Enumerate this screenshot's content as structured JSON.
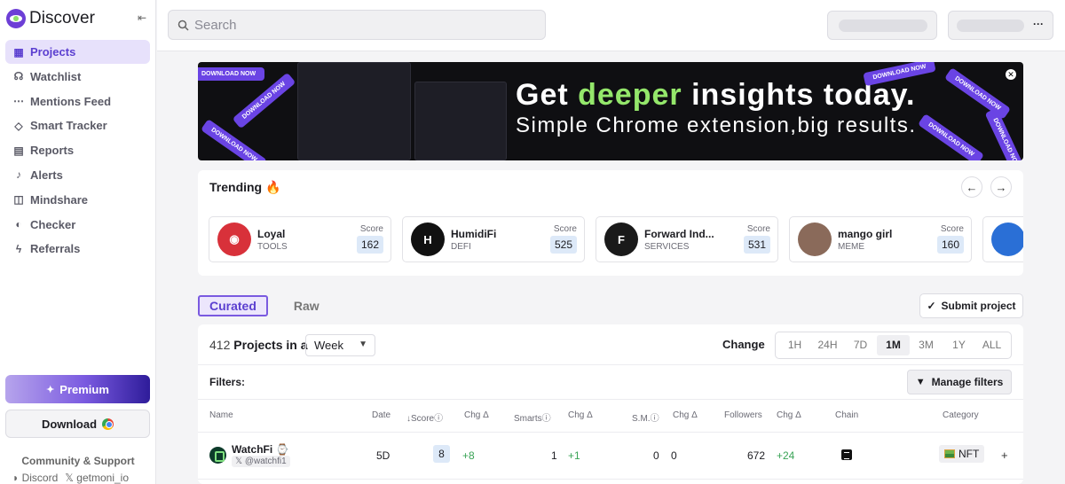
{
  "app": {
    "name": "Discover"
  },
  "sidebar": {
    "items": [
      {
        "label": "Projects",
        "icon": "projects-icon",
        "glyph": "▦",
        "active": true
      },
      {
        "label": "Watchlist",
        "icon": "watchlist-icon",
        "glyph": "☊",
        "active": false
      },
      {
        "label": "Mentions Feed",
        "icon": "mentions-icon",
        "glyph": "⋯",
        "active": false
      },
      {
        "label": "Smart Tracker",
        "icon": "tracker-icon",
        "glyph": "◇",
        "active": false
      },
      {
        "label": "Reports",
        "icon": "reports-icon",
        "glyph": "▤",
        "active": false
      },
      {
        "label": "Alerts",
        "icon": "bell-icon",
        "glyph": "♪",
        "active": false
      },
      {
        "label": "Mindshare",
        "icon": "mindshare-icon",
        "glyph": "◫",
        "active": false
      },
      {
        "label": "Checker",
        "icon": "checker-icon",
        "glyph": "◐",
        "active": false
      },
      {
        "label": "Referrals",
        "icon": "lightning-icon",
        "glyph": "ϟ",
        "active": false
      }
    ],
    "premium_label": "Premium",
    "download_label": "Download",
    "community_label": "Community & Support",
    "discord_label": "Discord",
    "x_label": "getmoni_io"
  },
  "topbar": {
    "search_placeholder": "Search"
  },
  "banner": {
    "headline_pre": "Get ",
    "headline_accent": "deeper",
    "headline_post": " insights today.",
    "subline": "Simple Chrome extension,big results.",
    "tag": "DOWNLOAD NOW",
    "accent_color": "#94e76b"
  },
  "trending": {
    "title": "Trending",
    "score_label": "Score",
    "cards": [
      {
        "name": "Loyal",
        "category": "TOOLS",
        "score": "162",
        "avatar_text": "◉",
        "avatar_bg": "#d8313a"
      },
      {
        "name": "HumidiFi",
        "category": "DEFI",
        "score": "525",
        "avatar_text": "H",
        "avatar_bg": "#111111"
      },
      {
        "name": "Forward Ind...",
        "category": "SERVICES",
        "score": "531",
        "avatar_text": "F",
        "avatar_bg": "#1a1a1a"
      },
      {
        "name": "mango girl",
        "category": "MEME",
        "score": "160",
        "avatar_text": "",
        "avatar_bg": "#8a6a5a"
      },
      {
        "name": "",
        "category": "",
        "score": "",
        "avatar_text": "",
        "avatar_bg": "#2a6fd6"
      }
    ]
  },
  "tabs": {
    "curated": "Curated",
    "raw": "Raw"
  },
  "submit_label": "Submit project",
  "table": {
    "count": "412",
    "count_suffix": "Projects in a",
    "period": "Week",
    "change_label": "Change",
    "ranges": [
      "1H",
      "24H",
      "7D",
      "1M",
      "3M",
      "1Y",
      "ALL"
    ],
    "active_range": "1M",
    "filters_label": "Filters:",
    "manage_label": "Manage filters",
    "headers": {
      "name": "Name",
      "date": "Date",
      "score": "Score",
      "chg1": "Chg",
      "smarts": "Smarts",
      "chg2": "Chg",
      "sm": "S.M.",
      "chg3": "Chg",
      "followers": "Followers",
      "chg4": "Chg",
      "chain": "Chain",
      "category": "Category"
    },
    "rows": [
      {
        "name": "WatchFi",
        "handle": "@watchfi1",
        "date": "5D",
        "score": "8",
        "score_chg": "+8",
        "smarts": "1",
        "smarts_chg": "+1",
        "sm": "0",
        "sm_chg": "0",
        "followers": "672",
        "followers_chg": "+24",
        "category": "NFT"
      }
    ]
  }
}
